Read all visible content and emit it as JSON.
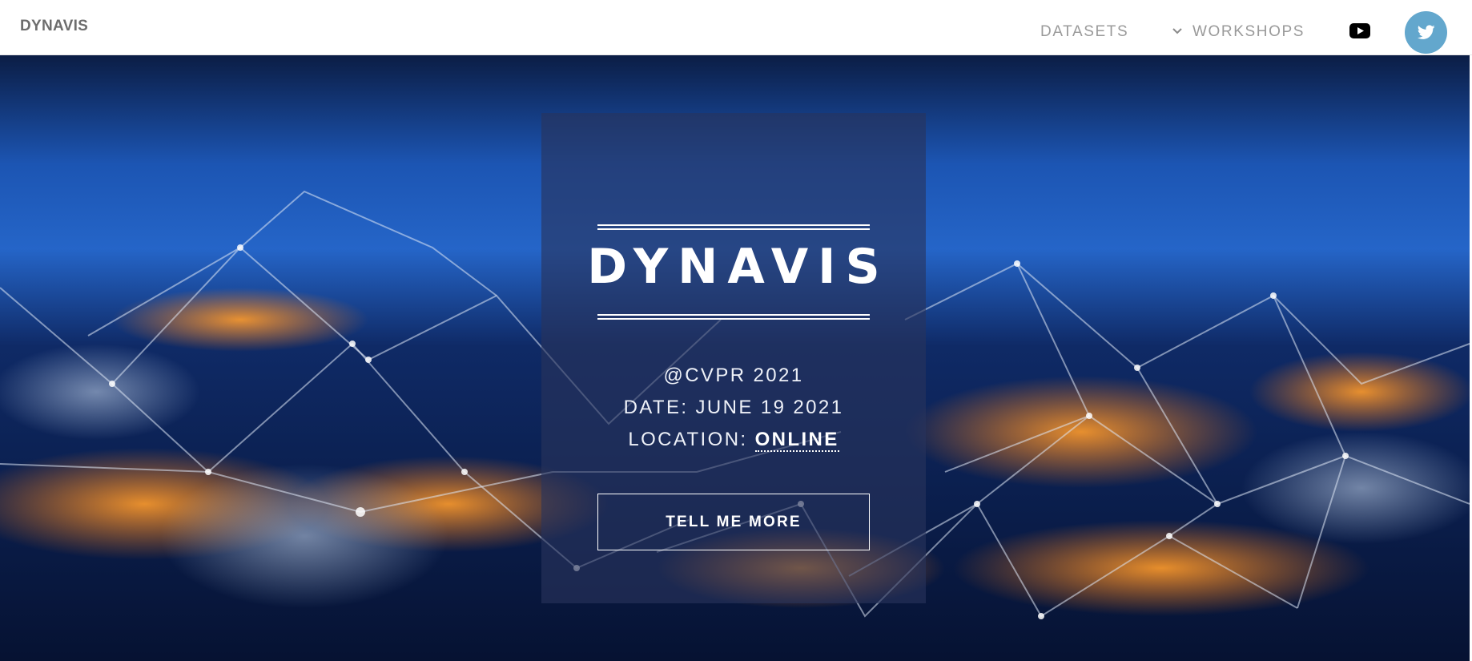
{
  "navbar": {
    "brand": "DYNAVIS",
    "links": [
      {
        "label": "DATASETS"
      },
      {
        "label": "WORKSHOPS",
        "icon": "chevron-down-icon"
      }
    ],
    "social": [
      {
        "icon": "youtube-icon"
      },
      {
        "icon": "twitter-icon",
        "color": "#63a7cd"
      }
    ]
  },
  "hero": {
    "title": "DYNAVIS",
    "venue": "@CVPR 2021",
    "date": "DATE: JUNE 19 2021",
    "location_label": "LOCATION: ",
    "location_value": "ONLINE",
    "cta_label": "TELL ME MORE",
    "background": "night-earth-network-image"
  }
}
